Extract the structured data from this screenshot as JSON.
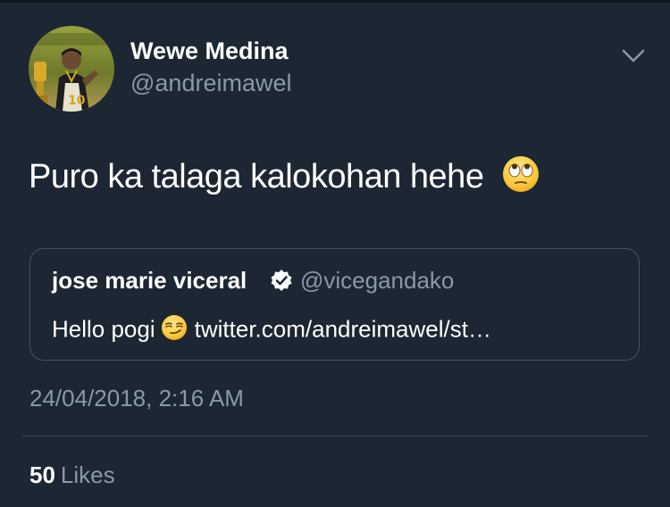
{
  "author": {
    "display_name": "Wewe Medina",
    "handle": "@andreimawel",
    "avatar_icon": "profile-photo"
  },
  "tweet": {
    "text": "Puro ka talaga kalokohan hehe",
    "emoji": "face-with-rolling-eyes-icon",
    "timestamp": "24/04/2018, 2:16 AM"
  },
  "quoted_tweet": {
    "display_name": "jose marie viceral",
    "verified": true,
    "handle": "@vicegandako",
    "text_prefix": "Hello pogi",
    "emoji": "smirking-face-icon",
    "link": "twitter.com/andreimawel/st…"
  },
  "stats": {
    "likes_count": "50",
    "likes_label": "Likes"
  },
  "colors": {
    "background": "#1c2733",
    "secondary_text": "#8899a6",
    "border": "#3d5466"
  }
}
